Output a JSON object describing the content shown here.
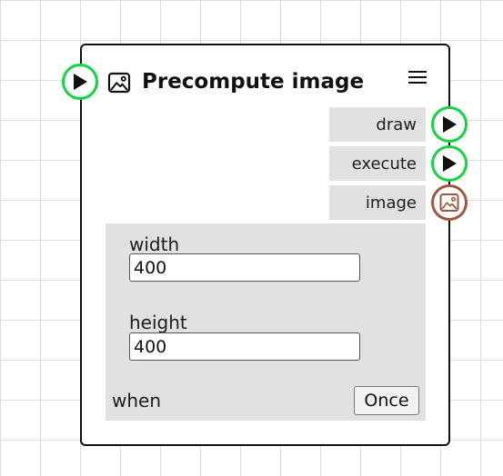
{
  "node": {
    "title": "Precompute image",
    "title_icon": "image-icon",
    "menu_icon": "hamburger-menu-icon"
  },
  "ports": {
    "input_exec_icon": "play-icon",
    "outputs": [
      {
        "label": "draw",
        "type": "exec",
        "icon": "play-icon",
        "color": "#11d63d"
      },
      {
        "label": "execute",
        "type": "exec",
        "icon": "play-icon",
        "color": "#11d63d"
      },
      {
        "label": "image",
        "type": "image",
        "icon": "image-icon",
        "color": "#a0573f"
      }
    ]
  },
  "fields": {
    "width": {
      "label": "width",
      "value": "400"
    },
    "height": {
      "label": "height",
      "value": "400"
    }
  },
  "when": {
    "label": "when",
    "button_label": "Once"
  },
  "colors": {
    "exec_port": "#11d63d",
    "image_port": "#a0573f",
    "panel_bg": "#e1e1e1",
    "grid": "#dedede"
  }
}
